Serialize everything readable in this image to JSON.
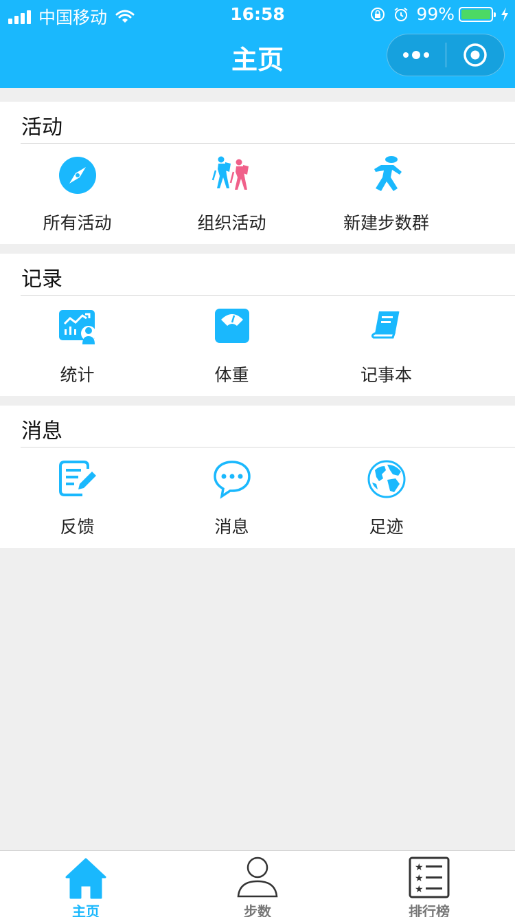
{
  "status_bar": {
    "carrier": "中国移动",
    "time": "16:58",
    "battery": "99%"
  },
  "nav": {
    "title": "主页"
  },
  "sections": [
    {
      "title": "活动",
      "items": [
        {
          "label": "所有活动",
          "icon": "compass-icon"
        },
        {
          "label": "组织活动",
          "icon": "hikers-icon"
        },
        {
          "label": "新建步数群",
          "icon": "walking-person-icon"
        }
      ]
    },
    {
      "title": "记录",
      "items": [
        {
          "label": "统计",
          "icon": "statistics-icon"
        },
        {
          "label": "体重",
          "icon": "scale-icon"
        },
        {
          "label": "记事本",
          "icon": "notebook-icon"
        }
      ]
    },
    {
      "title": "消息",
      "items": [
        {
          "label": "反馈",
          "icon": "feedback-edit-icon"
        },
        {
          "label": "消息",
          "icon": "chat-bubble-icon"
        },
        {
          "label": "足迹",
          "icon": "globe-icon"
        }
      ]
    }
  ],
  "tabbar": [
    {
      "label": "主页",
      "icon": "home-icon",
      "active": true
    },
    {
      "label": "步数",
      "icon": "user-icon",
      "active": false
    },
    {
      "label": "排行榜",
      "icon": "ranking-list-icon",
      "active": false
    }
  ],
  "colors": {
    "primary": "#1ab8fd",
    "background": "#efefef",
    "hiker_pink": "#f0608a",
    "battery_green": "#4cd964"
  }
}
